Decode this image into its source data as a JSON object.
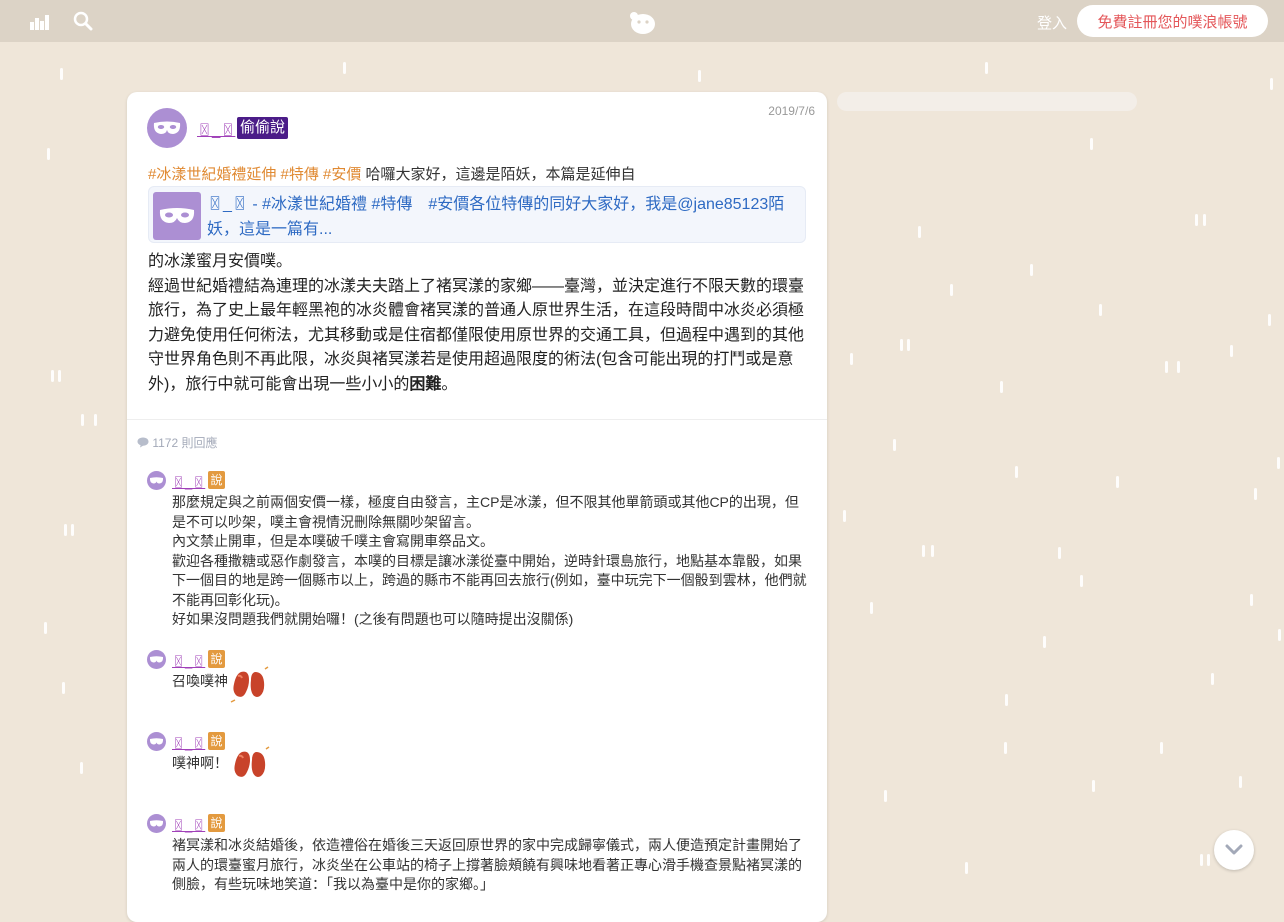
{
  "topbar": {
    "login_label": "登入",
    "signup_label": "免費註冊您的噗浪帳號"
  },
  "post": {
    "username": "〿_〿",
    "secret_badge": "偷偷說",
    "date": "2019/7/6",
    "tags": [
      "#冰漾世紀婚禮延伸",
      "#特傳",
      "#安價"
    ],
    "intro_text": "哈囉大家好，這邊是陌妖，本篇是延伸自",
    "quote": {
      "user": "〿_〿",
      "text": " - #冰漾世紀婚禮 #特傳　#安價各位特傳的同好大家好，我是@jane85123陌妖，這是一篇有..."
    },
    "body_p1": "的冰漾蜜月安價噗。",
    "body_p2_main": "經過世紀婚禮結為連理的冰漾夫夫踏上了褚冥漾的家鄉——臺灣，並決定進行不限天數的環臺旅行，為了史上最年輕黑袍的冰炎體會褚冥漾的普通人原世界生活，在這段時間中冰炎必須極力避免使用任何術法，尤其移動或是住宿都僅限使用原世界的交通工具，但過程中遇到的其他守世界角色則不再此限，冰炎與褚冥漾若是使用超過限度的術法(包含可能出現的打鬥或是意外)，旅行中就可能會出現一些小小的",
    "body_p2_bold": "困難",
    "body_p2_end": "。"
  },
  "replies_count_label": "1172 則回應",
  "replies": [
    {
      "user": "〿_〿",
      "badge": "說",
      "lines": [
        "那麼規定與之前兩個安價一樣，極度自由發言，主CP是冰漾，但不限其他單箭頭或其他CP的出現，但是不可以吵架，噗主會視情況刪除無關吵架留言。",
        "內文禁止開車，但是本噗破千噗主會寫開車祭品文。",
        "歡迎各種撒糖或惡作劇發言，本噗的目標是讓冰漾從臺中開始，逆時針環島旅行，地點基本靠骰，如果下一個目的地是跨一個縣市以上，跨過的縣市不能再回去旅行(例如，臺中玩完下一個骰到雲林，他們就不能再回彰化玩)。",
        "好如果沒問題我們就開始囉！(之後有問題也可以隨時提出沒關係)"
      ]
    },
    {
      "user": "〿_〿",
      "badge": "說",
      "text": "召喚噗神"
    },
    {
      "user": "〿_〿",
      "badge": "說",
      "text": "噗神啊！"
    },
    {
      "user": "〿_〿",
      "badge": "說",
      "lines": [
        "褚冥漾和冰炎結婚後，依造禮俗在婚後三天返回原世界的家中完成歸寧儀式，兩人便造預定計畫開始了兩人的環臺蜜月旅行，冰炎坐在公車站的椅子上撐著臉頰饒有興味地看著正專心滑手機查景點褚冥漾的側臉，有些玩味地笑道：「我以為臺中是你的家鄉。」"
      ]
    }
  ],
  "colors": {
    "background": "#efe6d9",
    "topbar": "#dcd3c6",
    "username_purple": "#a040b8",
    "secret_badge": "#4b1c88",
    "tag_orange": "#e08a33",
    "quote_link_blue": "#2e6ac3",
    "signup_red": "#e4575a"
  }
}
